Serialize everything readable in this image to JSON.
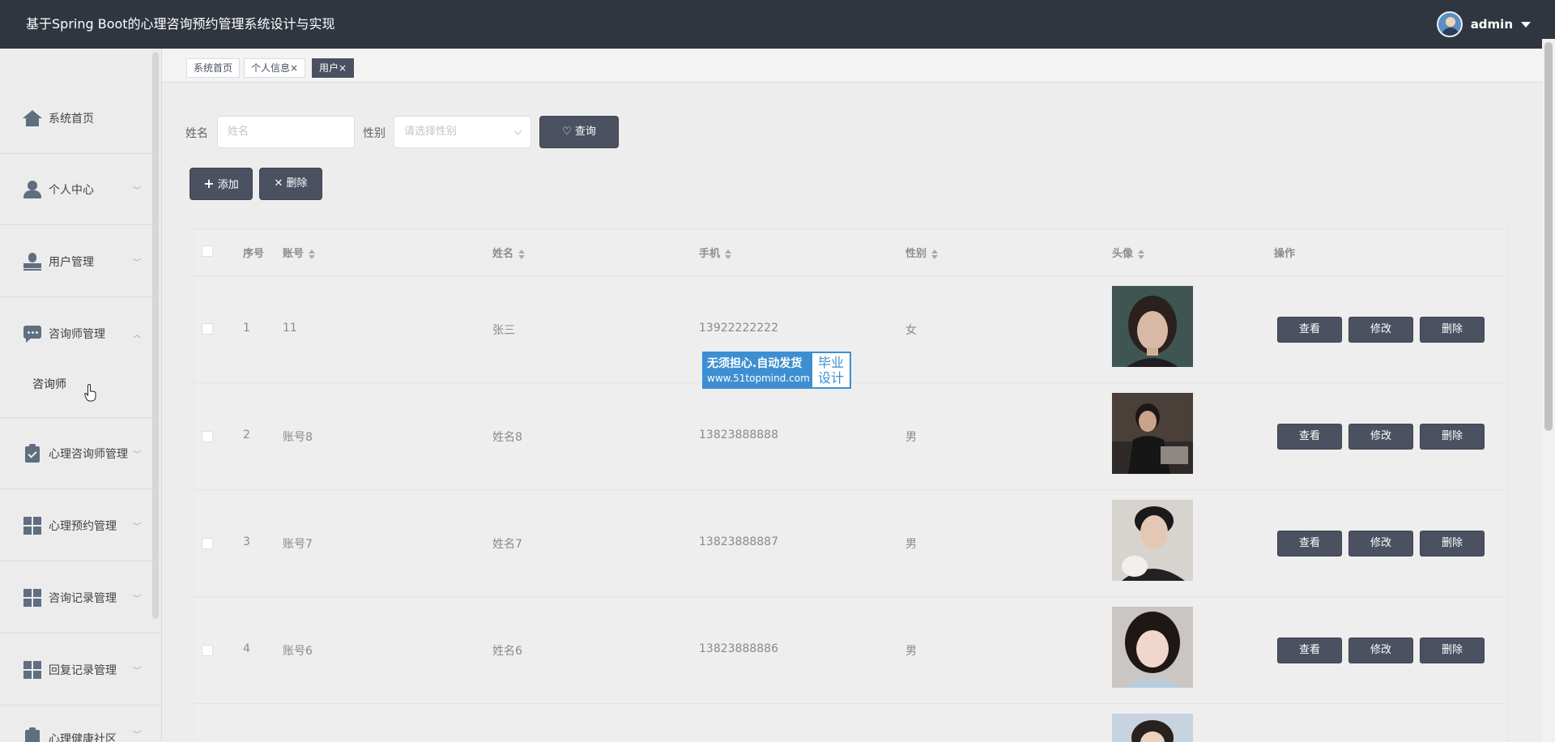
{
  "header": {
    "title": "基于Spring Boot的心理咨询预约管理系统设计与实现",
    "username": "admin"
  },
  "sidebar": {
    "items": [
      {
        "label": "系统首页",
        "icon": "home-icon"
      },
      {
        "label": "个人中心",
        "icon": "person-icon"
      },
      {
        "label": "用户管理",
        "icon": "stamp-icon"
      },
      {
        "label": "咨询师管理",
        "icon": "chat-icon",
        "expanded": true,
        "children": [
          "咨询师"
        ]
      },
      {
        "label": "心理咨询师管理",
        "icon": "clipboard-check-icon"
      },
      {
        "label": "心理预约管理",
        "icon": "grid-icon"
      },
      {
        "label": "咨询记录管理",
        "icon": "grid-icon"
      },
      {
        "label": "回复记录管理",
        "icon": "grid-icon"
      },
      {
        "label": "心理健康社区",
        "icon": "clipboard-icon"
      }
    ]
  },
  "tabs": [
    {
      "label": "系统首页",
      "closable": false
    },
    {
      "label": "个人信息",
      "closable": true
    },
    {
      "label": "用户",
      "closable": true,
      "active": true
    }
  ],
  "tab_close": "×",
  "search": {
    "name_label": "姓名",
    "name_placeholder": "姓名",
    "gender_label": "性别",
    "gender_placeholder": "请选择性别",
    "query_button": "查询"
  },
  "actions": {
    "add_button": "添加",
    "delete_button": "删除"
  },
  "table": {
    "columns": [
      "序号",
      "账号",
      "姓名",
      "手机",
      "性别",
      "头像",
      "操作"
    ],
    "rows": [
      {
        "index": "1",
        "account": "11",
        "name": "张三",
        "phone": "13922222222",
        "gender": "女"
      },
      {
        "index": "2",
        "account": "账号8",
        "name": "姓名8",
        "phone": "13823888888",
        "gender": "男"
      },
      {
        "index": "3",
        "account": "账号7",
        "name": "姓名7",
        "phone": "13823888887",
        "gender": "男"
      },
      {
        "index": "4",
        "account": "账号6",
        "name": "姓名6",
        "phone": "13823888886",
        "gender": "男"
      }
    ],
    "row_buttons": {
      "view": "查看",
      "edit": "修改",
      "delete": "删除"
    }
  },
  "watermark": {
    "line1": "无须担心.自动发货",
    "line2": "www.51topmind.com",
    "badge1": "毕业",
    "badge2": "设计"
  },
  "colors": {
    "header_bg": "#303640",
    "button_bg": "#4b5160",
    "page_bg": "#ededed",
    "watermark_blue": "#3d8fd1"
  }
}
